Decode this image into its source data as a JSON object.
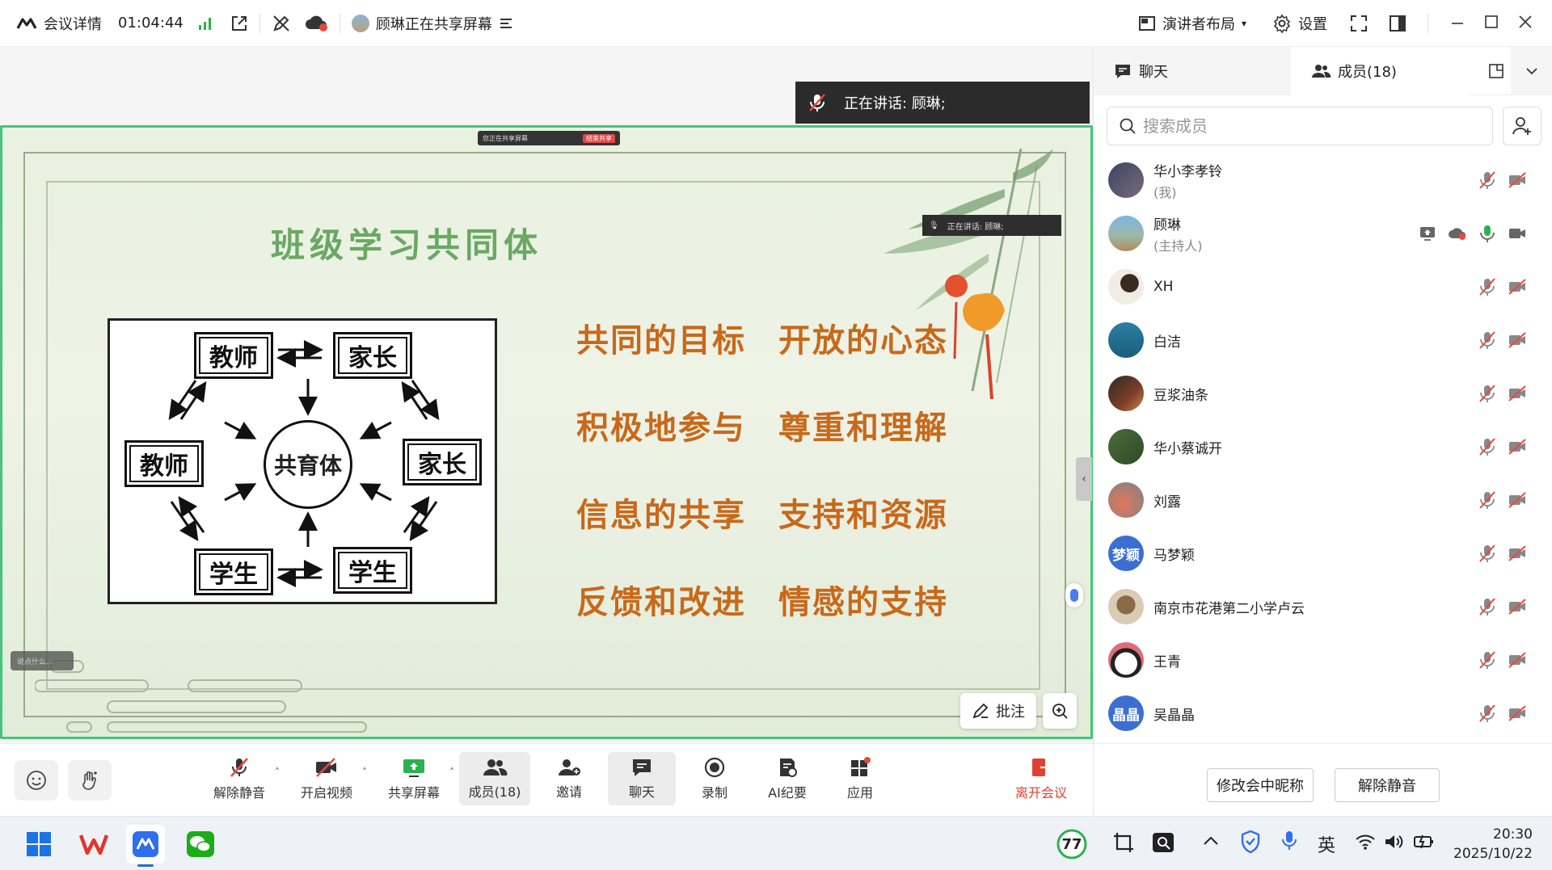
{
  "topbar": {
    "meeting_details": "会议详情",
    "timer": "01:04:44",
    "sharing_status": "顾琳正在共享屏幕",
    "layout_label": "演讲者布局",
    "settings_label": "设置"
  },
  "stage": {
    "speaking_label": "正在讲话:",
    "speaking_name": "顾琳;",
    "mini_share_text": "您正在共享屏幕",
    "mini_end_text": "结束共享",
    "mini_speaking_text": "正在讲话: 顾琳;",
    "mini_chat_text": "说点什么...",
    "annotate_label": "批注"
  },
  "slide": {
    "title": "班级学习共同体",
    "nodes": {
      "teacher_top": "教师",
      "parent_top": "家长",
      "teacher_left": "教师",
      "center": "共育体",
      "parent_right": "家长",
      "student_left": "学生",
      "student_right": "学生"
    },
    "phrases": [
      [
        "共同的目标",
        "开放的心态"
      ],
      [
        "积极地参与",
        "尊重和理解"
      ],
      [
        "信息的共享",
        "支持和资源"
      ],
      [
        "反馈和改进",
        "情感的支持"
      ]
    ]
  },
  "toolbar": {
    "unmute": "解除静音",
    "start_video": "开启视频",
    "share_screen": "共享屏幕",
    "members": "成员(18)",
    "invite": "邀请",
    "chat": "聊天",
    "record": "录制",
    "ai_minutes": "AI纪要",
    "apps": "应用",
    "leave": "离开会议"
  },
  "panel": {
    "tab_chat": "聊天",
    "tab_members": "成员(18)",
    "search_placeholder": "搜索成员",
    "members": [
      {
        "name": "华小李孝铃",
        "role": "(我)"
      },
      {
        "name": "顾琳",
        "role": "(主持人)"
      },
      {
        "name": "XH",
        "role": ""
      },
      {
        "name": "白洁",
        "role": ""
      },
      {
        "name": "豆浆油条",
        "role": ""
      },
      {
        "name": "华小蔡诚开",
        "role": ""
      },
      {
        "name": "刘露",
        "role": ""
      },
      {
        "name": "马梦颖",
        "role": "",
        "avatar_text": "梦颖"
      },
      {
        "name": "南京市花港第二小学卢云",
        "role": ""
      },
      {
        "name": "王青",
        "role": ""
      },
      {
        "name": "吴晶晶",
        "role": "",
        "avatar_text": "晶晶"
      }
    ],
    "rename_button": "修改会中昵称",
    "unmute_button": "解除静音"
  },
  "taskbar": {
    "badge": "77",
    "ime": "英",
    "time": "20:30",
    "date": "2025/10/22"
  },
  "colors": {
    "accent_green": "#43c67b",
    "phrase_orange": "#c8691a",
    "title_green": "#6aa864",
    "leave_red": "#e0412f",
    "avatar_blue": "#3c6fd1"
  }
}
